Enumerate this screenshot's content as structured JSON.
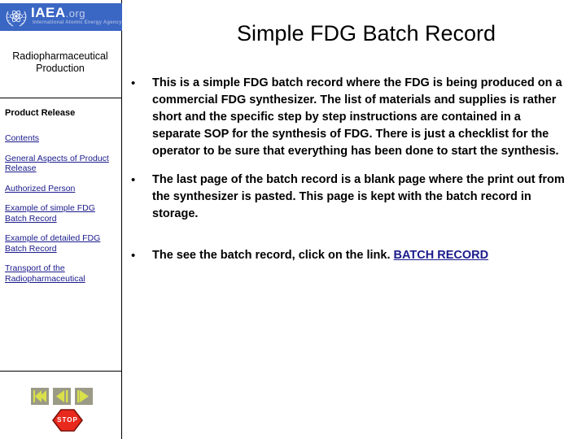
{
  "sidebar": {
    "logo": {
      "wordmark": "IAEA",
      "domain": ".org",
      "tagline": "International Atomic Energy Agency",
      "banner_color": "#3a66c4",
      "emblem_icon": "iaea-atom-laurel-icon"
    },
    "title": "Radiopharmaceutical Production",
    "section_label": "Product Release",
    "links": [
      {
        "label": "Contents"
      },
      {
        "label": "General Aspects of Product Release"
      },
      {
        "label": "Authorized Person"
      },
      {
        "label": "Example of simple FDG Batch Record"
      },
      {
        "label": "Example of detailed FDG Batch Record"
      },
      {
        "label": "Transport of the Radiopharmaceutical"
      }
    ],
    "link_color": "#1a1a8c",
    "nav": {
      "first": {
        "icon": "first-slide-icon",
        "label": "First"
      },
      "prev": {
        "icon": "previous-slide-icon",
        "label": "Previous"
      },
      "next": {
        "icon": "next-slide-icon",
        "label": "Next"
      },
      "button_color": "#9a9a86",
      "glyph_color": "#d9e04a"
    },
    "stop": {
      "label": "STOP",
      "icon": "stop-octagon-icon",
      "fill_color": "#e8291c",
      "border_color": "#7a1008"
    }
  },
  "main": {
    "title": "Simple FDG Batch Record",
    "bullets": [
      {
        "marker": "•",
        "text": "This is a simple FDG batch record where the FDG is being produced on a commercial FDG synthesizer.  The list of materials and supplies is rather short and the specific step by step instructions are contained in a separate SOP for the synthesis of FDG.  There is just a checklist for the operator to be sure that everything has been done to start the synthesis."
      },
      {
        "marker": "•",
        "text": "The last page of the batch record is a blank page where the print out from the synthesizer is pasted.  This page is kept with the batch record in storage."
      }
    ],
    "link_bullet": {
      "marker": "•",
      "text": "The see the batch record, click on the link.  ",
      "link_label": "BATCH RECORD",
      "link_color": "#1a1a8c"
    }
  }
}
